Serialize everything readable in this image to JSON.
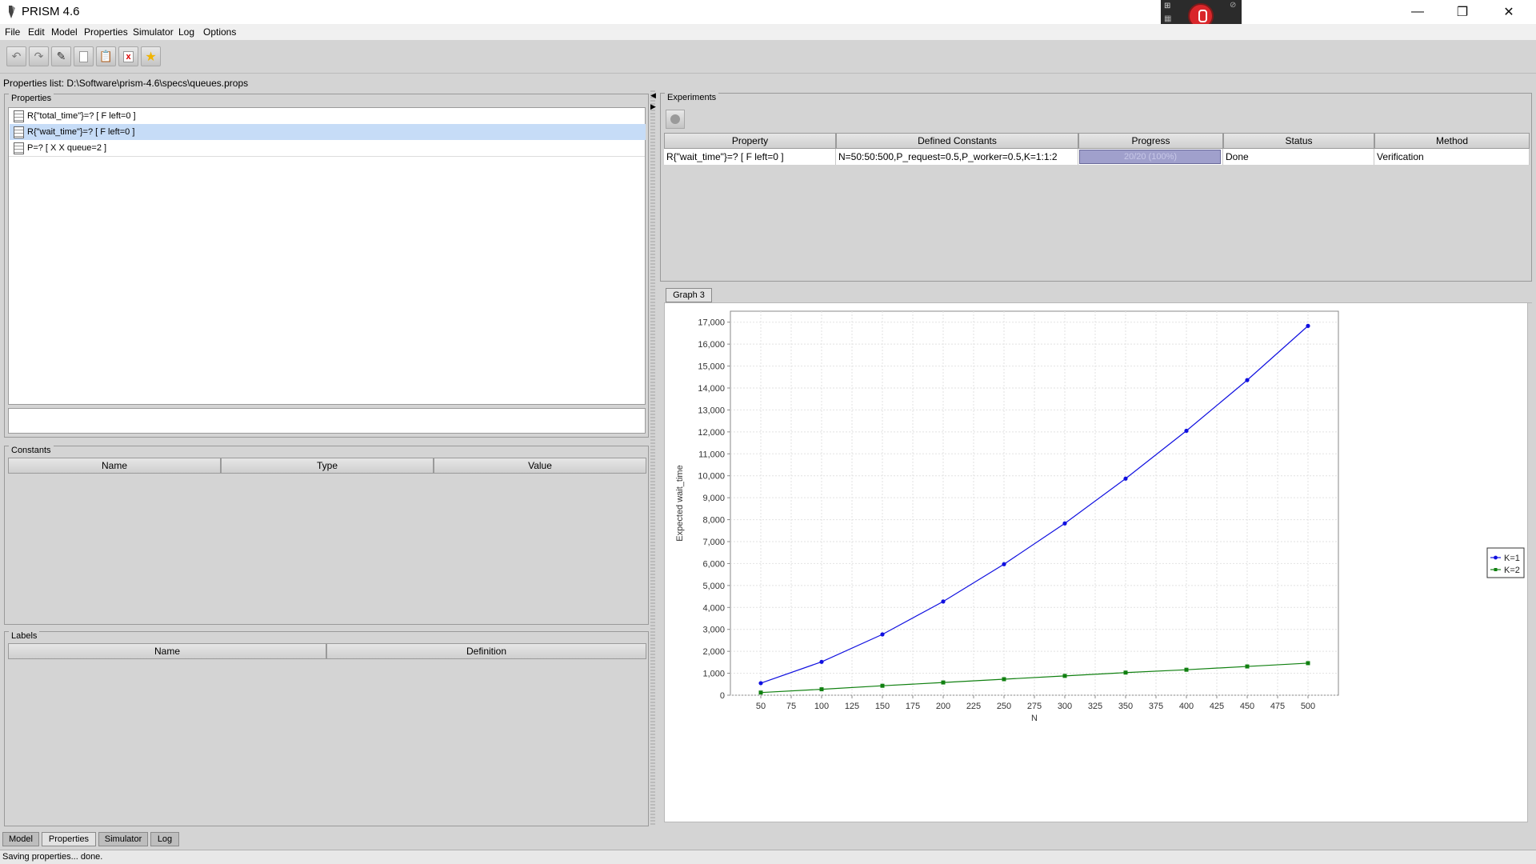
{
  "window": {
    "title": "PRISM 4.6"
  },
  "menu": [
    "File",
    "Edit",
    "Model",
    "Properties",
    "Simulator",
    "Log",
    "Options"
  ],
  "toolbar": {
    "icons": [
      "undo-icon",
      "redo-icon",
      "edit-icon",
      "new-icon",
      "paste-icon",
      "delete-icon",
      "star-icon"
    ]
  },
  "properties_list_path": "Properties list: D:\\Software\\prism-4.6\\specs\\queues.props",
  "properties_panel": {
    "title": "Properties",
    "items": [
      "R{\"total_time\"}=? [ F left=0 ]",
      "R{\"wait_time\"}=? [ F left=0 ]",
      "P=? [ X X queue=2 ]"
    ],
    "selected_index": 1
  },
  "constants_panel": {
    "title": "Constants",
    "columns": [
      "Name",
      "Type",
      "Value"
    ]
  },
  "labels_panel": {
    "title": "Labels",
    "columns": [
      "Name",
      "Definition"
    ]
  },
  "experiments": {
    "title": "Experiments",
    "columns": [
      "Property",
      "Defined Constants",
      "Progress",
      "Status",
      "Method"
    ],
    "rows": [
      {
        "property": "R{\"wait_time\"}=? [ F left=0 ]",
        "constants": "N=50:50:500,P_request=0.5,P_worker=0.5,K=1:1:2",
        "progress": "20/20 (100%)",
        "progress_fraction": 1.0,
        "status": "Done",
        "method": "Verification"
      }
    ]
  },
  "graph_tab": "Graph 3",
  "chart_data": {
    "type": "line",
    "xlabel": "N",
    "ylabel": "Expected wait_time",
    "xlim": [
      25,
      525
    ],
    "ylim": [
      0,
      17500
    ],
    "grid": true,
    "legend_position": "right",
    "x_ticks": [
      50,
      75,
      100,
      125,
      150,
      175,
      200,
      225,
      250,
      275,
      300,
      325,
      350,
      375,
      400,
      425,
      450,
      475,
      500
    ],
    "y_ticks": [
      0,
      1000,
      2000,
      3000,
      4000,
      5000,
      6000,
      7000,
      8000,
      9000,
      10000,
      11000,
      12000,
      13000,
      14000,
      15000,
      16000,
      17000
    ],
    "x": [
      50,
      100,
      150,
      200,
      250,
      300,
      350,
      400,
      450,
      500
    ],
    "series": [
      {
        "name": "K=1",
        "color": "#1010e0",
        "marker": "circle",
        "values": [
          550,
          1520,
          2770,
          4270,
          5970,
          7830,
          9870,
          12050,
          14360,
          16830
        ]
      },
      {
        "name": "K=2",
        "color": "#108010",
        "marker": "square",
        "values": [
          120,
          270,
          430,
          580,
          730,
          880,
          1030,
          1160,
          1310,
          1460
        ]
      }
    ]
  },
  "bottom_tabs": [
    "Model",
    "Properties",
    "Simulator",
    "Log"
  ],
  "active_bottom_tab": "Properties",
  "status_text": "Saving properties... done."
}
